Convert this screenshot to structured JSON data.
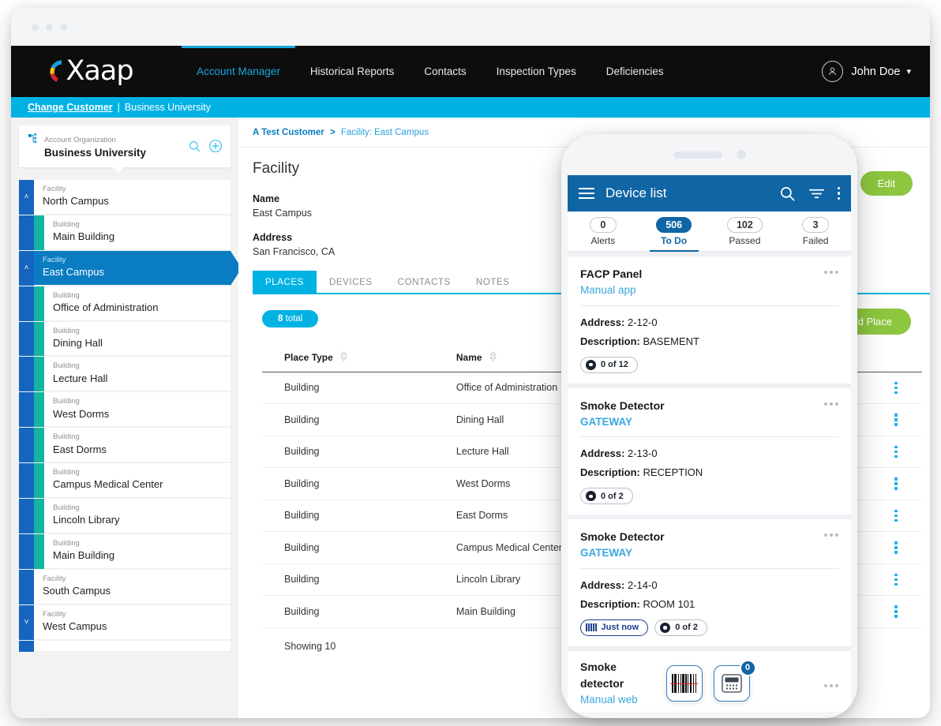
{
  "browser": {
    "dots": 3
  },
  "topnav": {
    "logo_text": "Xaap",
    "items": [
      {
        "label": "Account Manager",
        "active": true
      },
      {
        "label": "Historical Reports",
        "active": false
      },
      {
        "label": "Contacts",
        "active": false
      },
      {
        "label": "Inspection Types",
        "active": false
      },
      {
        "label": "Deficiencies",
        "active": false
      }
    ],
    "user_name": "John Doe",
    "caret": "⌄"
  },
  "customer_bar": {
    "change_link": "Change Customer",
    "separator": "|",
    "customer": "Business University"
  },
  "sidebar": {
    "org_label": "Account Organization",
    "org_name": "Business University",
    "search_icon": "search-icon",
    "add_icon": "add-circle-icon",
    "tree": [
      {
        "type": "Facility",
        "name": "North Campus",
        "level": "facility",
        "chevron": "˄",
        "selected": false
      },
      {
        "type": "Building",
        "name": "Main Building",
        "level": "building",
        "selected": false
      },
      {
        "type": "Facility",
        "name": "East Campus",
        "level": "facility",
        "chevron": "˄",
        "selected": true
      },
      {
        "type": "Building",
        "name": "Office of Administration",
        "level": "building",
        "selected": false
      },
      {
        "type": "Building",
        "name": "Dining Hall",
        "level": "building",
        "selected": false
      },
      {
        "type": "Building",
        "name": "Lecture Hall",
        "level": "building",
        "selected": false
      },
      {
        "type": "Building",
        "name": "West Dorms",
        "level": "building",
        "selected": false
      },
      {
        "type": "Building",
        "name": "East Dorms",
        "level": "building",
        "selected": false
      },
      {
        "type": "Building",
        "name": "Campus Medical Center",
        "level": "building",
        "selected": false
      },
      {
        "type": "Building",
        "name": "Lincoln Library",
        "level": "building",
        "selected": false
      },
      {
        "type": "Building",
        "name": "Main Building",
        "level": "building",
        "selected": false
      },
      {
        "type": "Facility",
        "name": "South Campus",
        "level": "facility",
        "chevron": "",
        "selected": false
      },
      {
        "type": "Facility",
        "name": "West Campus",
        "level": "facility",
        "chevron": "˅",
        "selected": false
      }
    ]
  },
  "main": {
    "breadcrumb": {
      "root": "A Test Customer",
      "sep": ">",
      "current": "Facility: East Campus"
    },
    "panel_title": "Facility",
    "fields": [
      {
        "label": "Name",
        "value": "East Campus"
      },
      {
        "label": "Address",
        "value": "San Francisco, CA"
      }
    ],
    "edit_label": "Edit",
    "tabs": [
      {
        "label": "PLACES",
        "active": true
      },
      {
        "label": "DEVICES",
        "active": false
      },
      {
        "label": "CONTACTS",
        "active": false
      },
      {
        "label": "NOTES",
        "active": false
      }
    ],
    "total_count": "8",
    "total_suffix": "total",
    "add_place_label": "Add Place",
    "table": {
      "columns": [
        "Place Type",
        "Name"
      ],
      "rows": [
        [
          "Building",
          "Office of Administration"
        ],
        [
          "Building",
          "Dining Hall"
        ],
        [
          "Building",
          "Lecture Hall"
        ],
        [
          "Building",
          "West Dorms"
        ],
        [
          "Building",
          "East Dorms"
        ],
        [
          "Building",
          "Campus Medical Center"
        ],
        [
          "Building",
          "Lincoln Library"
        ],
        [
          "Building",
          "Main Building"
        ]
      ],
      "footer": "Showing 10"
    }
  },
  "phone": {
    "app_bar": {
      "title": "Device list",
      "menu_icon": "hamburger-icon",
      "search_icon": "search-icon",
      "filter_icon": "filter-icon",
      "overflow_icon": "kebab-icon"
    },
    "stats": [
      {
        "count": "0",
        "label": "Alerts",
        "active": false
      },
      {
        "count": "506",
        "label": "To Do",
        "active": true
      },
      {
        "count": "102",
        "label": "Passed",
        "active": false
      },
      {
        "count": "3",
        "label": "Failed",
        "active": false
      }
    ],
    "devices": [
      {
        "title": "FACP Panel",
        "subtitle": "Manual app",
        "subtitle_style": "plain",
        "address_label": "Address:",
        "address": "2-12-0",
        "description_label": "Description:",
        "description": "BASEMENT",
        "chips": [
          {
            "kind": "count",
            "text": "0 of 12"
          }
        ]
      },
      {
        "title": "Smoke Detector",
        "subtitle": "GATEWAY",
        "subtitle_style": "bold",
        "address_label": "Address:",
        "address": "2-13-0",
        "description_label": "Description:",
        "description": "RECEPTION",
        "chips": [
          {
            "kind": "count",
            "text": "0 of 2"
          }
        ]
      },
      {
        "title": "Smoke Detector",
        "subtitle": "GATEWAY",
        "subtitle_style": "bold",
        "address_label": "Address:",
        "address": "2-14-0",
        "description_label": "Description:",
        "description": "ROOM 101",
        "chips": [
          {
            "kind": "barcode",
            "text": "Just now"
          },
          {
            "kind": "count",
            "text": "0 of 2"
          }
        ]
      }
    ],
    "compact_device": {
      "title": "Smoke detector",
      "subtitle": "Manual web",
      "tiles": [
        {
          "icon": "barcode-scanner-icon",
          "badge": ""
        },
        {
          "icon": "keypad-icon",
          "badge": "0"
        }
      ]
    }
  },
  "colors": {
    "brand_cyan": "#00b2e3",
    "nav_black": "#0d0d0d",
    "facility_blue": "#1565c0",
    "building_teal": "#14b5a0",
    "selected_blue": "#0a7cc1",
    "green_button": "#8dc63f",
    "phone_blue": "#1065a4",
    "link_blue": "#3ba7e0"
  }
}
